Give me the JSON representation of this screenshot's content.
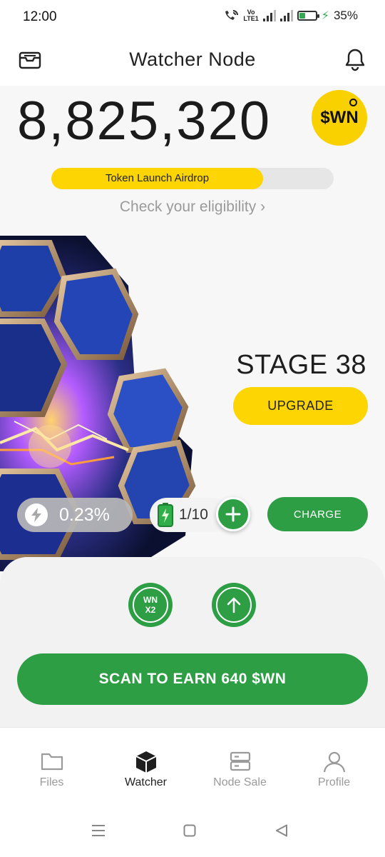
{
  "status_bar": {
    "time": "12:00",
    "battery_percent": "35%",
    "battery_level": 0.35,
    "volte_top": "Vo",
    "volte_bottom": "LTE1"
  },
  "header": {
    "title": "Watcher Node",
    "left_icon": "inbox-icon",
    "right_icon": "bell-icon"
  },
  "balance": {
    "amount": "8,825,320",
    "token_badge": "$WN"
  },
  "airdrop": {
    "label": "Token Launch Airdrop",
    "progress": 0.75,
    "link_text": "Check your eligibility",
    "link_chevron": "›"
  },
  "stage": {
    "title": "STAGE 38",
    "upgrade_label": "UPGRADE"
  },
  "stats": {
    "speed_value": "0.23%",
    "charges": "1/10",
    "charge_label": "CHARGE"
  },
  "actions": {
    "multiplier_line1": "WN",
    "multiplier_line2": "X2",
    "scan_label": "SCAN TO EARN 640 $WN"
  },
  "nav": {
    "items": [
      {
        "label": "Files",
        "icon": "folder-icon"
      },
      {
        "label": "Watcher",
        "icon": "cube-icon",
        "active": true
      },
      {
        "label": "Node Sale",
        "icon": "server-icon"
      },
      {
        "label": "Profile",
        "icon": "person-icon"
      }
    ]
  },
  "colors": {
    "accent_yellow": "#fcd502",
    "accent_green": "#2e9e45",
    "text_dark": "#1f1f1f",
    "muted": "#9a9a9a"
  }
}
